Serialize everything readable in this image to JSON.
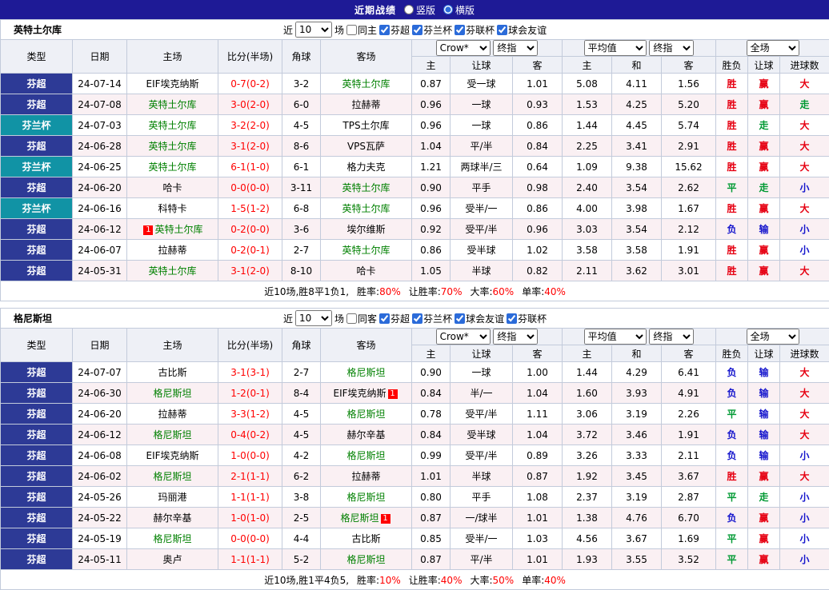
{
  "page": {
    "title": "近期战绩",
    "layout_options": [
      {
        "label": "竖版",
        "checked": false
      },
      {
        "label": "横版",
        "checked": true
      }
    ]
  },
  "columns": {
    "type": "类型",
    "date": "日期",
    "home": "主场",
    "score": "比分(半场)",
    "corner": "角球",
    "away": "客场",
    "ah_home": "主",
    "ah_line": "让球",
    "ah_away": "客",
    "eu_home": "主",
    "eu_draw": "和",
    "eu_away": "客",
    "result": "胜负",
    "handicap": "让球",
    "goals": "进球数"
  },
  "colors": {
    "topbar_bg": "#1e1a96",
    "header_bg": "#eef0f6",
    "alt_row_bg": "#faf0f3",
    "border": "#c3cbdb",
    "focus_team": "#008000",
    "score": "#ff0000",
    "badge_bg": "#ff0000",
    "red": "#e60012",
    "green": "#009933",
    "blue": "#1414cc"
  },
  "league_colors": {
    "芬超": "#2d3a96",
    "芬兰杯": "#1193a5"
  },
  "outcome_color_map": {
    "胜": "red",
    "平": "green",
    "负": "blue",
    "赢": "red",
    "走": "green",
    "输": "blue",
    "大": "red",
    "小": "blue"
  },
  "sections": [
    {
      "team": "英特土尔库",
      "filter": {
        "recent_label": "近",
        "count": "10",
        "games_label": "场",
        "venue": {
          "label": "同主",
          "checked": false
        },
        "leagues": [
          {
            "label": "芬超",
            "checked": true
          },
          {
            "label": "芬兰杯",
            "checked": true
          },
          {
            "label": "芬联杯",
            "checked": true
          },
          {
            "label": "球会友谊",
            "checked": true
          }
        ]
      },
      "selects": {
        "company": "Crow*",
        "asia_time": "终指",
        "europe_source": "平均值",
        "europe_time": "终指",
        "scope": "全场"
      },
      "rows": [
        {
          "league": "芬超",
          "date": "24-07-14",
          "home": {
            "name": "EIF埃克纳斯"
          },
          "score": "0-7(0-2)",
          "corner": "3-2",
          "away": {
            "name": "英特土尔库",
            "focus": true
          },
          "ah": [
            "0.87",
            "受一球",
            "1.01"
          ],
          "eu": [
            "5.08",
            "4.11",
            "1.56"
          ],
          "result": "胜",
          "handicap": "赢",
          "goals": "大"
        },
        {
          "league": "芬超",
          "date": "24-07-08",
          "home": {
            "name": "英特土尔库",
            "focus": true
          },
          "score": "3-0(2-0)",
          "corner": "6-0",
          "away": {
            "name": "拉赫蒂"
          },
          "ah": [
            "0.96",
            "一球",
            "0.93"
          ],
          "eu": [
            "1.53",
            "4.25",
            "5.20"
          ],
          "result": "胜",
          "handicap": "赢",
          "goals": "走"
        },
        {
          "league": "芬兰杯",
          "date": "24-07-03",
          "home": {
            "name": "英特土尔库",
            "focus": true
          },
          "score": "3-2(2-0)",
          "corner": "4-5",
          "away": {
            "name": "TPS土尔库"
          },
          "ah": [
            "0.96",
            "一球",
            "0.86"
          ],
          "eu": [
            "1.44",
            "4.45",
            "5.74"
          ],
          "result": "胜",
          "handicap": "走",
          "goals": "大"
        },
        {
          "league": "芬超",
          "date": "24-06-28",
          "home": {
            "name": "英特土尔库",
            "focus": true
          },
          "score": "3-1(2-0)",
          "corner": "8-6",
          "away": {
            "name": "VPS瓦萨"
          },
          "ah": [
            "1.04",
            "平/半",
            "0.84"
          ],
          "eu": [
            "2.25",
            "3.41",
            "2.91"
          ],
          "result": "胜",
          "handicap": "赢",
          "goals": "大"
        },
        {
          "league": "芬兰杯",
          "date": "24-06-25",
          "home": {
            "name": "英特土尔库",
            "focus": true
          },
          "score": "6-1(1-0)",
          "corner": "6-1",
          "away": {
            "name": "格力夫克"
          },
          "ah": [
            "1.21",
            "两球半/三",
            "0.64"
          ],
          "eu": [
            "1.09",
            "9.38",
            "15.62"
          ],
          "result": "胜",
          "handicap": "赢",
          "goals": "大"
        },
        {
          "league": "芬超",
          "date": "24-06-20",
          "home": {
            "name": "哈卡"
          },
          "score": "0-0(0-0)",
          "corner": "3-11",
          "away": {
            "name": "英特土尔库",
            "focus": true
          },
          "ah": [
            "0.90",
            "平手",
            "0.98"
          ],
          "eu": [
            "2.40",
            "3.54",
            "2.62"
          ],
          "result": "平",
          "handicap": "走",
          "goals": "小"
        },
        {
          "league": "芬兰杯",
          "date": "24-06-16",
          "home": {
            "name": "科特卡"
          },
          "score": "1-5(1-2)",
          "corner": "6-8",
          "away": {
            "name": "英特土尔库",
            "focus": true
          },
          "ah": [
            "0.96",
            "受半/一",
            "0.86"
          ],
          "eu": [
            "4.00",
            "3.98",
            "1.67"
          ],
          "result": "胜",
          "handicap": "赢",
          "goals": "大"
        },
        {
          "league": "芬超",
          "date": "24-06-12",
          "home": {
            "name": "英特土尔库",
            "focus": true,
            "badge": "1",
            "badge_side": "left"
          },
          "score": "0-2(0-0)",
          "corner": "3-6",
          "away": {
            "name": "埃尔维斯"
          },
          "ah": [
            "0.92",
            "受平/半",
            "0.96"
          ],
          "eu": [
            "3.03",
            "3.54",
            "2.12"
          ],
          "result": "负",
          "handicap": "输",
          "goals": "小"
        },
        {
          "league": "芬超",
          "date": "24-06-07",
          "home": {
            "name": "拉赫蒂"
          },
          "score": "0-2(0-1)",
          "corner": "2-7",
          "away": {
            "name": "英特土尔库",
            "focus": true
          },
          "ah": [
            "0.86",
            "受半球",
            "1.02"
          ],
          "eu": [
            "3.58",
            "3.58",
            "1.91"
          ],
          "result": "胜",
          "handicap": "赢",
          "goals": "小"
        },
        {
          "league": "芬超",
          "date": "24-05-31",
          "home": {
            "name": "英特土尔库",
            "focus": true
          },
          "score": "3-1(2-0)",
          "corner": "8-10",
          "away": {
            "name": "哈卡"
          },
          "ah": [
            "1.05",
            "半球",
            "0.82"
          ],
          "eu": [
            "2.11",
            "3.62",
            "3.01"
          ],
          "result": "胜",
          "handicap": "赢",
          "goals": "大"
        }
      ],
      "summary": {
        "prefix": "近10场,胜8平1负1,",
        "stats": [
          {
            "label": "胜率:",
            "value": "80%"
          },
          {
            "label": "让胜率:",
            "value": "70%"
          },
          {
            "label": "大率:",
            "value": "60%"
          },
          {
            "label": "单率:",
            "value": "40%"
          }
        ]
      }
    },
    {
      "team": "格尼斯坦",
      "filter": {
        "recent_label": "近",
        "count": "10",
        "games_label": "场",
        "venue": {
          "label": "同客",
          "checked": false
        },
        "leagues": [
          {
            "label": "芬超",
            "checked": true
          },
          {
            "label": "芬兰杯",
            "checked": true
          },
          {
            "label": "球会友谊",
            "checked": true
          },
          {
            "label": "芬联杯",
            "checked": true
          }
        ]
      },
      "selects": {
        "company": "Crow*",
        "asia_time": "终指",
        "europe_source": "平均值",
        "europe_time": "终指",
        "scope": "全场"
      },
      "rows": [
        {
          "league": "芬超",
          "date": "24-07-07",
          "home": {
            "name": "古比斯"
          },
          "score": "3-1(3-1)",
          "corner": "2-7",
          "away": {
            "name": "格尼斯坦",
            "focus": true
          },
          "ah": [
            "0.90",
            "一球",
            "1.00"
          ],
          "eu": [
            "1.44",
            "4.29",
            "6.41"
          ],
          "result": "负",
          "handicap": "输",
          "goals": "大"
        },
        {
          "league": "芬超",
          "date": "24-06-30",
          "home": {
            "name": "格尼斯坦",
            "focus": true
          },
          "score": "1-2(0-1)",
          "corner": "8-4",
          "away": {
            "name": "EIF埃克纳斯",
            "badge": "1",
            "badge_side": "right"
          },
          "ah": [
            "0.84",
            "半/一",
            "1.04"
          ],
          "eu": [
            "1.60",
            "3.93",
            "4.91"
          ],
          "result": "负",
          "handicap": "输",
          "goals": "大"
        },
        {
          "league": "芬超",
          "date": "24-06-20",
          "home": {
            "name": "拉赫蒂"
          },
          "score": "3-3(1-2)",
          "corner": "4-5",
          "away": {
            "name": "格尼斯坦",
            "focus": true
          },
          "ah": [
            "0.78",
            "受平/半",
            "1.11"
          ],
          "eu": [
            "3.06",
            "3.19",
            "2.26"
          ],
          "result": "平",
          "handicap": "输",
          "goals": "大"
        },
        {
          "league": "芬超",
          "date": "24-06-12",
          "home": {
            "name": "格尼斯坦",
            "focus": true
          },
          "score": "0-4(0-2)",
          "corner": "4-5",
          "away": {
            "name": "赫尔辛基"
          },
          "ah": [
            "0.84",
            "受半球",
            "1.04"
          ],
          "eu": [
            "3.72",
            "3.46",
            "1.91"
          ],
          "result": "负",
          "handicap": "输",
          "goals": "大"
        },
        {
          "league": "芬超",
          "date": "24-06-08",
          "home": {
            "name": "EIF埃克纳斯"
          },
          "score": "1-0(0-0)",
          "corner": "4-2",
          "away": {
            "name": "格尼斯坦",
            "focus": true
          },
          "ah": [
            "0.99",
            "受平/半",
            "0.89"
          ],
          "eu": [
            "3.26",
            "3.33",
            "2.11"
          ],
          "result": "负",
          "handicap": "输",
          "goals": "小"
        },
        {
          "league": "芬超",
          "date": "24-06-02",
          "home": {
            "name": "格尼斯坦",
            "focus": true
          },
          "score": "2-1(1-1)",
          "corner": "6-2",
          "away": {
            "name": "拉赫蒂"
          },
          "ah": [
            "1.01",
            "半球",
            "0.87"
          ],
          "eu": [
            "1.92",
            "3.45",
            "3.67"
          ],
          "result": "胜",
          "handicap": "赢",
          "goals": "大"
        },
        {
          "league": "芬超",
          "date": "24-05-26",
          "home": {
            "name": "玛丽港"
          },
          "score": "1-1(1-1)",
          "corner": "3-8",
          "away": {
            "name": "格尼斯坦",
            "focus": true
          },
          "ah": [
            "0.80",
            "平手",
            "1.08"
          ],
          "eu": [
            "2.37",
            "3.19",
            "2.87"
          ],
          "result": "平",
          "handicap": "走",
          "goals": "小"
        },
        {
          "league": "芬超",
          "date": "24-05-22",
          "home": {
            "name": "赫尔辛基"
          },
          "score": "1-0(1-0)",
          "corner": "2-5",
          "away": {
            "name": "格尼斯坦",
            "focus": true,
            "badge": "1",
            "badge_side": "right"
          },
          "ah": [
            "0.87",
            "一/球半",
            "1.01"
          ],
          "eu": [
            "1.38",
            "4.76",
            "6.70"
          ],
          "result": "负",
          "handicap": "赢",
          "goals": "小"
        },
        {
          "league": "芬超",
          "date": "24-05-19",
          "home": {
            "name": "格尼斯坦",
            "focus": true
          },
          "score": "0-0(0-0)",
          "corner": "4-4",
          "away": {
            "name": "古比斯"
          },
          "ah": [
            "0.85",
            "受半/一",
            "1.03"
          ],
          "eu": [
            "4.56",
            "3.67",
            "1.69"
          ],
          "result": "平",
          "handicap": "赢",
          "goals": "小"
        },
        {
          "league": "芬超",
          "date": "24-05-11",
          "home": {
            "name": "奥卢"
          },
          "score": "1-1(1-1)",
          "corner": "5-2",
          "away": {
            "name": "格尼斯坦",
            "focus": true
          },
          "ah": [
            "0.87",
            "平/半",
            "1.01"
          ],
          "eu": [
            "1.93",
            "3.55",
            "3.52"
          ],
          "result": "平",
          "handicap": "赢",
          "goals": "小"
        }
      ],
      "summary": {
        "prefix": "近10场,胜1平4负5,",
        "stats": [
          {
            "label": "胜率:",
            "value": "10%"
          },
          {
            "label": "让胜率:",
            "value": "40%"
          },
          {
            "label": "大率:",
            "value": "50%"
          },
          {
            "label": "单率:",
            "value": "40%"
          }
        ]
      }
    }
  ]
}
